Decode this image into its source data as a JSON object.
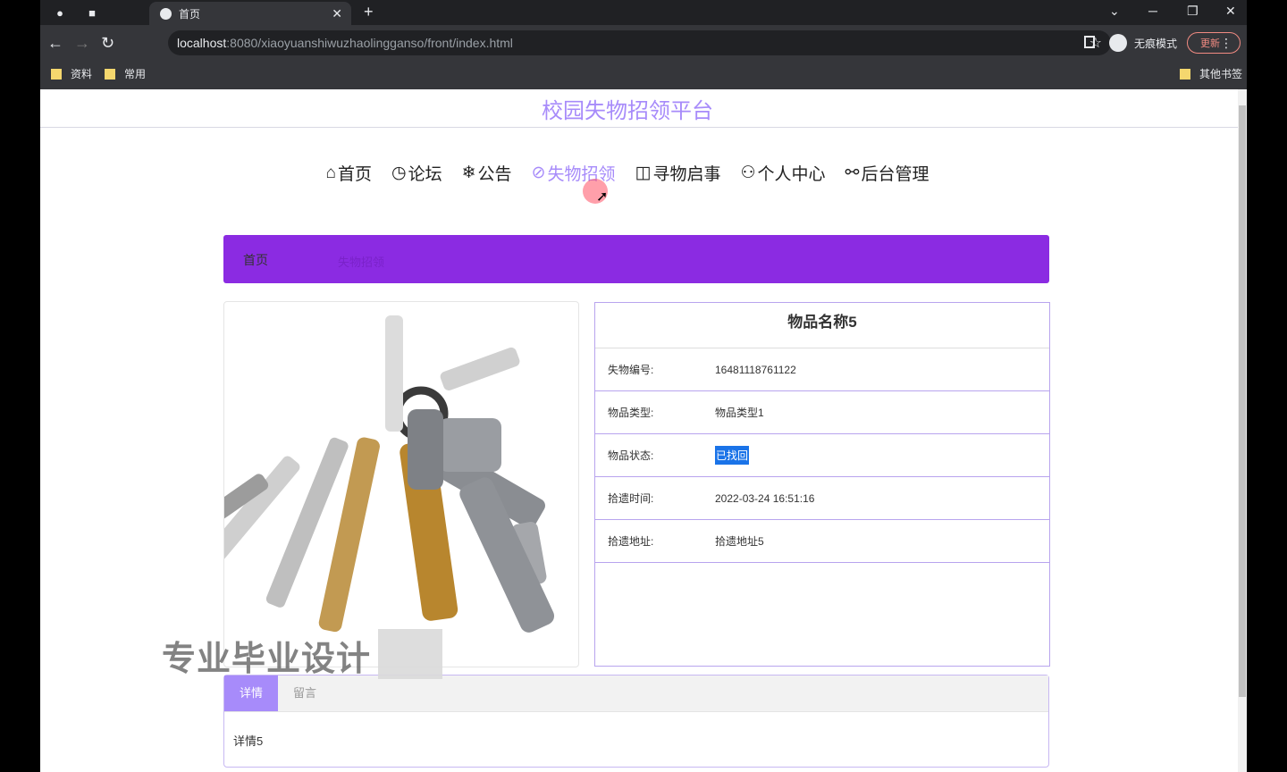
{
  "browser": {
    "tab_title": "首页",
    "url_host": "localhost",
    "url_path": ":8080/xiaoyuanshiwuzhaolingganso/front/index.html",
    "incognito_label": "无痕模式",
    "update_label": "更新",
    "bookmarks": [
      "资料",
      "常用"
    ],
    "other_bookmarks": "其他书签"
  },
  "site": {
    "title": "校园失物招领平台",
    "nav": [
      {
        "icon": "home-icon",
        "glyph": "⌂",
        "label": "首页"
      },
      {
        "icon": "clock-icon",
        "glyph": "◷",
        "label": "论坛"
      },
      {
        "icon": "gear-icon",
        "glyph": "❄",
        "label": "公告"
      },
      {
        "icon": "link-icon",
        "glyph": "⊘",
        "label": "失物招领"
      },
      {
        "icon": "glasses-icon",
        "glyph": "◫",
        "label": "寻物启事"
      },
      {
        "icon": "user-icon",
        "glyph": "⚇",
        "label": "个人中心"
      },
      {
        "icon": "chain-icon",
        "glyph": "⚯",
        "label": "后台管理"
      }
    ],
    "active_nav": "失物招领"
  },
  "breadcrumb": {
    "home": "首页",
    "current": "失物招领"
  },
  "item": {
    "name": "物品名称5",
    "fields": [
      {
        "label": "失物编号:",
        "value": "16481118761122"
      },
      {
        "label": "物品类型:",
        "value": "物品类型1"
      },
      {
        "label": "物品状态:",
        "value": "已找回"
      },
      {
        "label": "拾遗时间:",
        "value": "2022-03-24 16:51:16"
      },
      {
        "label": "拾遗地址:",
        "value": "拾遗地址5"
      }
    ]
  },
  "watermark": "专业毕业设计",
  "detail_tabs": {
    "tabs": [
      "详情",
      "留言"
    ],
    "active": "详情",
    "content": "详情5"
  }
}
